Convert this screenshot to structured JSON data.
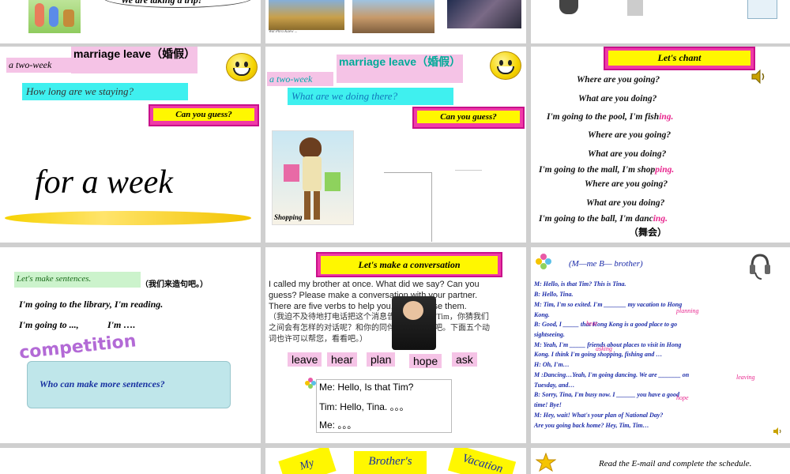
{
  "slide1": {
    "bubble": "We are taking a trip!"
  },
  "slide2": {
    "caption": "Wat Phra Kaew ..."
  },
  "slide4": {
    "answer_label": "a two-week",
    "topic": "marriage leave（婚假）",
    "question": "How long are we staying?",
    "guess_button": "Can you guess?",
    "big_answer": "for a week"
  },
  "slide5": {
    "answer_label": "a two-week",
    "topic": "marriage leave（婚假）",
    "question": "What are we doing there?",
    "guess_button": "Can you guess?",
    "shopping_label": "Shopping"
  },
  "slide6": {
    "title": "Let's chant",
    "lines": [
      {
        "text": "Where are you going?",
        "hl": ""
      },
      {
        "text": "What are you doing?",
        "hl": ""
      },
      {
        "text": "I'm going to the pool, I'm fish",
        "hl": "ing."
      },
      {
        "text": "Where are you going?",
        "hl": ""
      },
      {
        "text": "What are you doing?",
        "hl": ""
      },
      {
        "text": "I'm going to the mall, I'm shop",
        "hl": "ping."
      },
      {
        "text": "Where are you going?",
        "hl": ""
      },
      {
        "text": "What are you doing?",
        "hl": ""
      },
      {
        "text": "I'm going to the ball, I'm danc",
        "hl": "ing."
      }
    ],
    "note": "（舞会）"
  },
  "slide7": {
    "title": "Let's make sentences.",
    "title_cn": "（我们来造句吧。）",
    "line1": "I'm going to the library, I'm reading.",
    "line2a": "I'm going to ...,",
    "line2b": "I'm ….",
    "competition": "competition",
    "scroll_text": "Who can make more sentences?"
  },
  "slide8": {
    "title": "Let's make a conversation",
    "para_en": "I called my brother at once. What did we say? Can you guess? Please make a conversation with your partner. There are five verbs to help you, you can use them.",
    "para_cn": "（我迫不及待地打电话把这个消息告诉了我哥哥 Tim，你猜我们之间会有怎样的对话呢？和你的同伴一起编一下吧。下面五个动词也许可以帮您，看看吧。）",
    "verbs": [
      "leave",
      "hear",
      "plan",
      "hope",
      "ask"
    ],
    "dialog": [
      "Me: Hello, Is that Tim?",
      "Tim: Hello, Tina. 。。。",
      "Me:  。。。"
    ]
  },
  "slide9": {
    "header": "(M—me   B— brother)",
    "lines": [
      "M: Hello, is that Tim? This is Tina.",
      "B: Hello, Tina.",
      "M: Tim, I'm so exited. I'm _______ my vacation to Hong",
      "    Kong.",
      "B: Good, I _____ that Hong Kong is a good place to go",
      "    sightseeing.",
      "M: Yeah, I'm _____ friends about places to visit in Hong",
      "    Kong. I think I'm going shopping, fishing and …",
      "H: Oh, I'm…",
      "M :Dancing…Yeah, I'm going dancing. We are _______ on",
      "    Tuesday, and…",
      "B: Sorry, Tina, I'm busy now. I ______ you have a good",
      "    time! Bye!",
      "M: Hey, wait! What's your plan of National Day?",
      "    Are you going back home? Hey, Tim, Tim…"
    ],
    "hints": {
      "planning": "planning",
      "hear": "hear",
      "asking": "asking",
      "leaving": "leaving",
      "hope": "hope"
    }
  },
  "slide11": {
    "sign1": "Brother's",
    "sign2": "Vacation",
    "sign3": "My"
  },
  "slide12": {
    "text": "Read the E-mail and complete the schedule."
  },
  "colors": {
    "pink_box": "#f5c3e6",
    "cyan_box": "#3ff0ef",
    "magenta": "#f03aa7",
    "yellow": "#fff700",
    "dialog_blue": "#1a2aa8",
    "hint_pink": "#e8268e"
  },
  "icons": [
    "smiley-icon",
    "speaker-icon",
    "flower-icon",
    "headset-icon",
    "star-icon"
  ]
}
